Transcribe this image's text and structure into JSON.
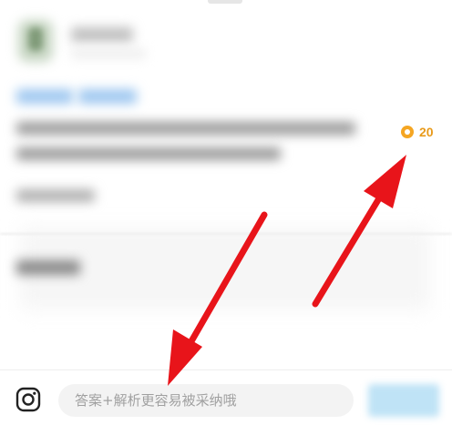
{
  "question": {
    "reward": {
      "icon": "coin-icon",
      "value": "20",
      "color": "#f5a623"
    }
  },
  "answer_bar": {
    "camera_icon": "camera-icon",
    "input_placeholder": "答案+解析更容易被采纳哦",
    "input_value": ""
  },
  "annotations": {
    "arrow_color": "#e8141a"
  }
}
